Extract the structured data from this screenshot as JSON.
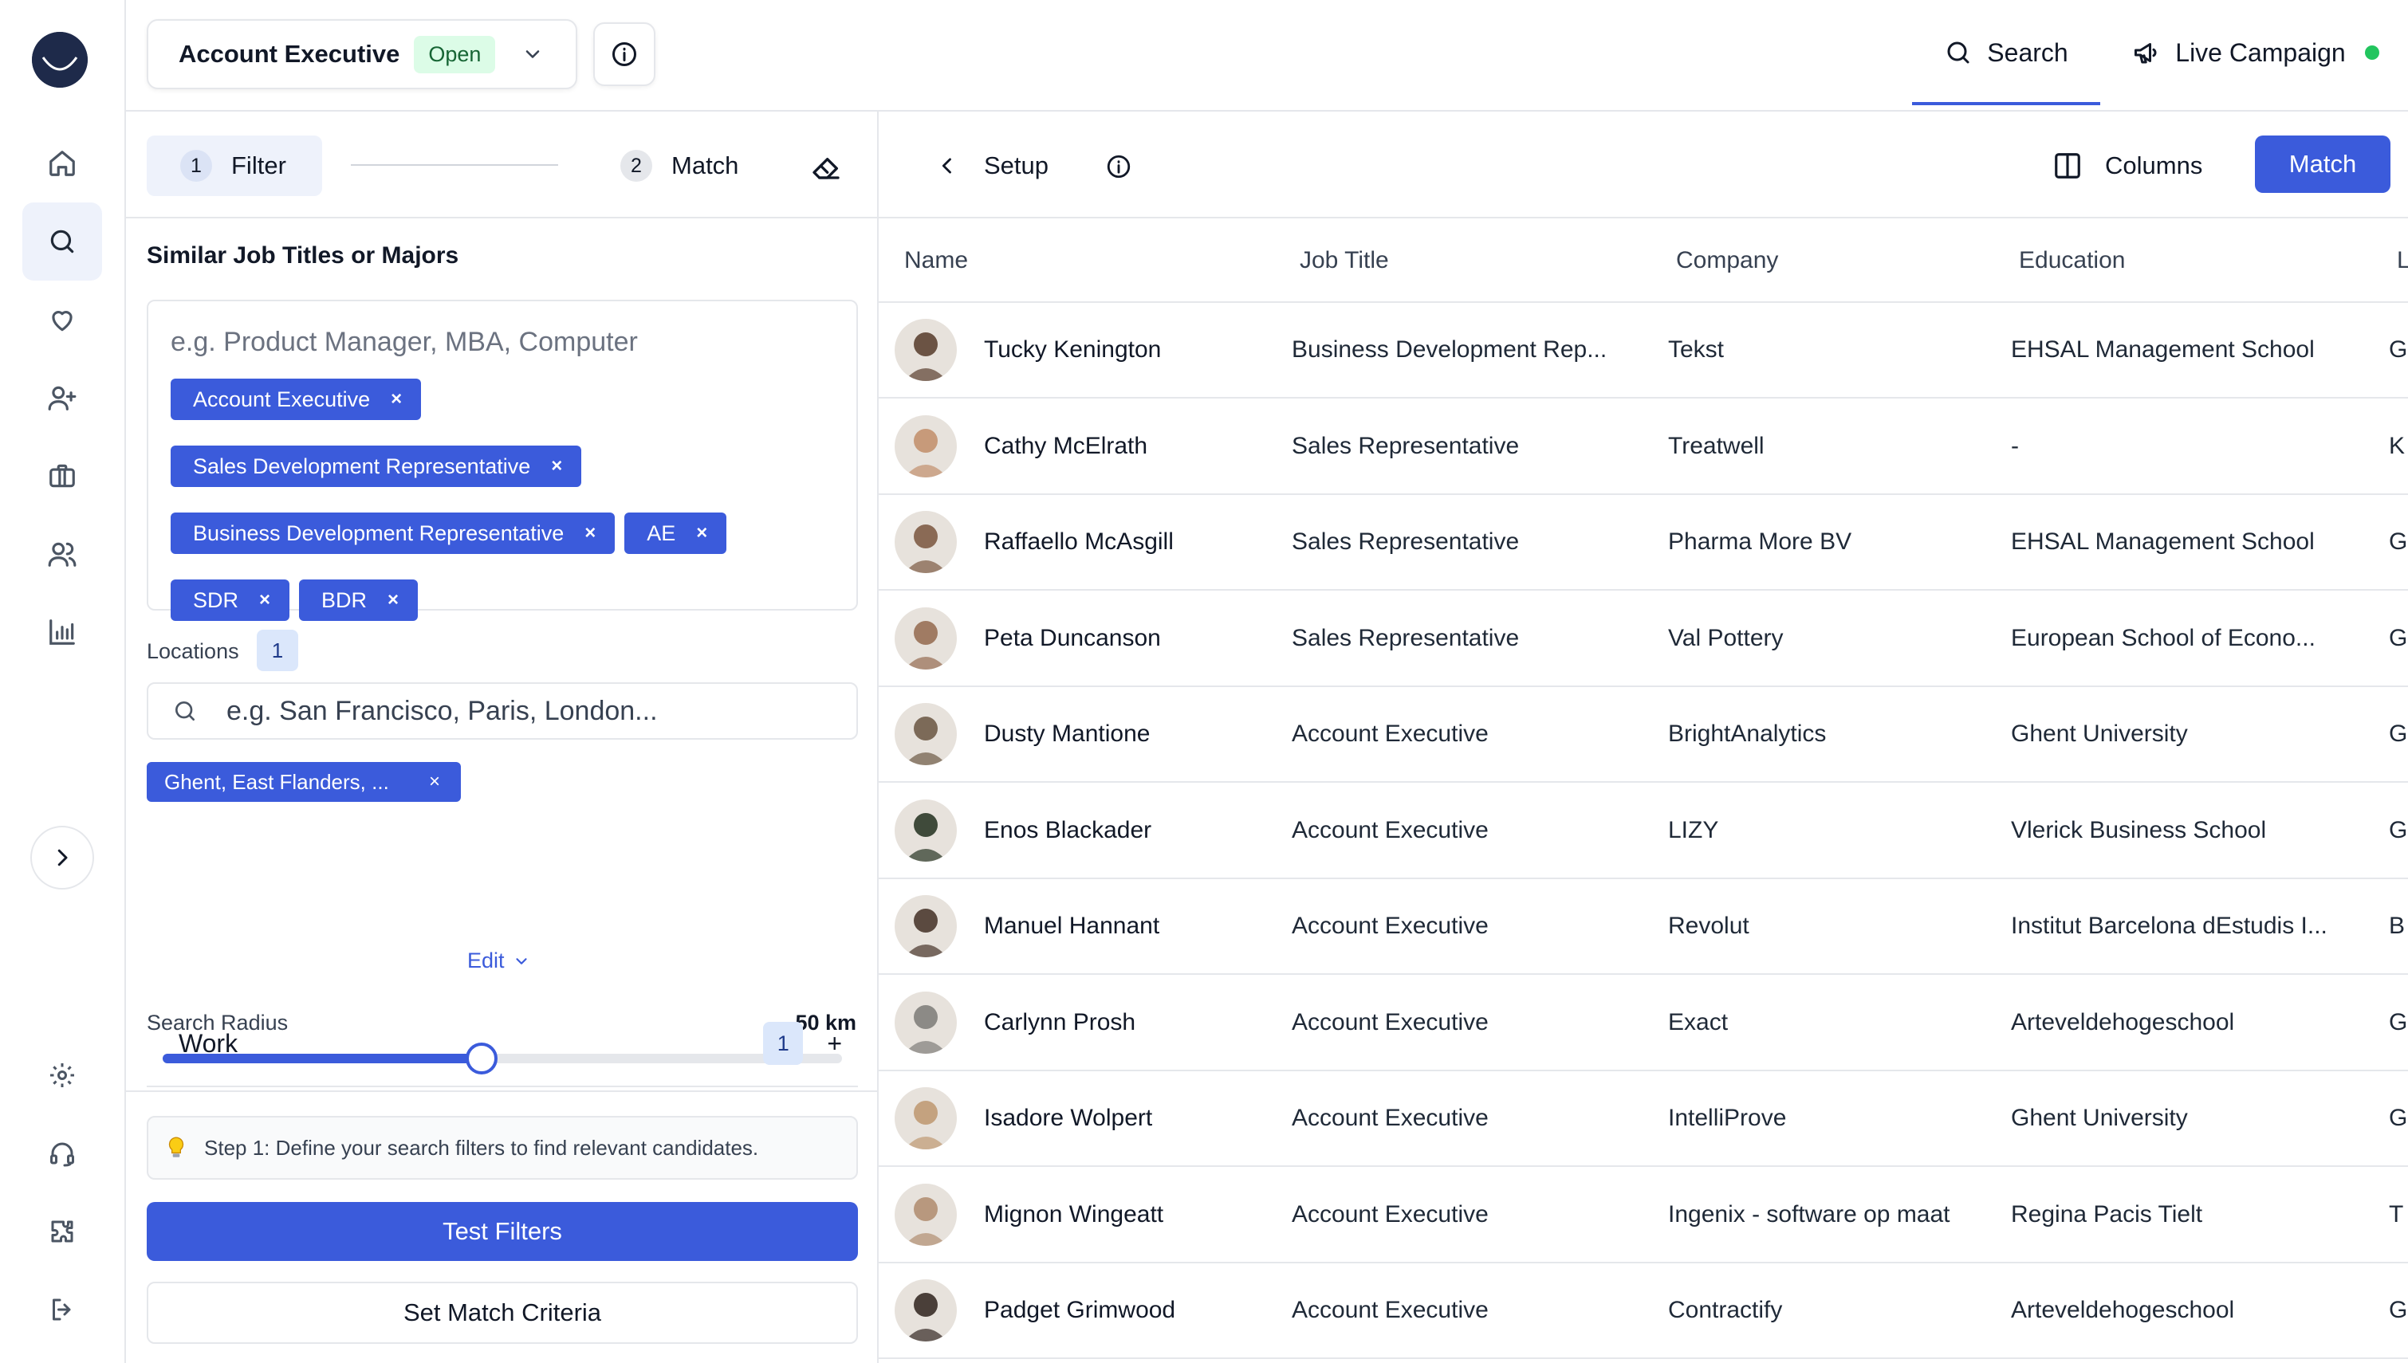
{
  "topbar": {
    "job_title": "Account Executive",
    "job_status": "Open",
    "tabs": [
      {
        "label": "Search",
        "icon": "search-icon",
        "active": true
      },
      {
        "label": "Live Campaign",
        "icon": "megaphone-icon",
        "status_color": "#22c55e"
      }
    ]
  },
  "rail": {
    "items": [
      {
        "name": "home-icon"
      },
      {
        "name": "search-icon",
        "active": true
      },
      {
        "name": "heart-icon"
      },
      {
        "name": "user-plus-icon"
      },
      {
        "name": "briefcase-icon"
      },
      {
        "name": "users-icon"
      },
      {
        "name": "bar-chart-icon"
      }
    ],
    "bottom_items": [
      {
        "name": "gear-icon"
      },
      {
        "name": "headset-icon"
      },
      {
        "name": "puzzle-icon"
      },
      {
        "name": "logout-icon"
      }
    ]
  },
  "steps": [
    {
      "num": "1",
      "label": "Filter",
      "active": true
    },
    {
      "num": "2",
      "label": "Match",
      "active": false
    }
  ],
  "filters": {
    "section_label": "Similar Job Titles or Majors",
    "placeholder": "e.g. Product Manager, MBA, Computer",
    "chips": [
      "Account Executive",
      "Sales Development Representative",
      "Business Development Representative",
      "AE",
      "SDR",
      "BDR"
    ],
    "locations_label": "Locations",
    "locations_count": "1",
    "locations_placeholder": "e.g. San Francisco, Paris, London...",
    "location_chip": "Ghent, East Flanders, ...",
    "edit_label": "Edit",
    "radius_label": "Search Radius",
    "radius_value": "50 km",
    "radius_fraction": 0.47,
    "work_label": "Work",
    "work_count": "1",
    "work_add": "+",
    "hint_icon": "lightbulb-icon",
    "hint": "Step 1: Define your search filters to find relevant candidates.",
    "test_label": "Test Filters",
    "criteria_label": "Set Match Criteria"
  },
  "toolbar": {
    "back_label": "Setup",
    "columns_label": "Columns",
    "match_label": "Match"
  },
  "table": {
    "columns": [
      "Name",
      "Job Title",
      "Company",
      "Education",
      "L"
    ],
    "rows": [
      {
        "name": "Tucky Kenington",
        "job": "Business Development Rep...",
        "company": "Tekst",
        "education": "EHSAL Management School",
        "loc": "G",
        "avatar": "#6b5344"
      },
      {
        "name": "Cathy McElrath",
        "job": "Sales Representative",
        "company": "Treatwell",
        "education": "-",
        "loc": "K",
        "avatar": "#c79a7a"
      },
      {
        "name": "Raffaello McAsgill",
        "job": "Sales Representative",
        "company": "Pharma More BV",
        "education": "EHSAL Management School",
        "loc": "G",
        "avatar": "#8a6a55"
      },
      {
        "name": "Peta Duncanson",
        "job": "Sales Representative",
        "company": "Val Pottery",
        "education": "European School of Econo...",
        "loc": "G",
        "avatar": "#a07b63"
      },
      {
        "name": "Dusty Mantione",
        "job": "Account Executive",
        "company": "BrightAnalytics",
        "education": "Ghent University",
        "loc": "G",
        "avatar": "#7c6a58"
      },
      {
        "name": "Enos Blackader",
        "job": "Account Executive",
        "company": "LIZY",
        "education": "Vlerick Business School",
        "loc": "G",
        "avatar": "#3f4a3a"
      },
      {
        "name": "Manuel Hannant",
        "job": "Account Executive",
        "company": "Revolut",
        "education": "Institut Barcelona dEstudis I...",
        "loc": "B",
        "avatar": "#5b4a40"
      },
      {
        "name": "Carlynn Prosh",
        "job": "Account Executive",
        "company": "Exact",
        "education": "Arteveldehogeschool",
        "loc": "G",
        "avatar": "#8c8a86"
      },
      {
        "name": "Isadore Wolpert",
        "job": "Account Executive",
        "company": "IntelliProve",
        "education": "Ghent University",
        "loc": "G",
        "avatar": "#c4a27f"
      },
      {
        "name": "Mignon Wingeatt",
        "job": "Account Executive",
        "company": "Ingenix - software op maat",
        "education": "Regina Pacis Tielt",
        "loc": "T",
        "avatar": "#b8987e"
      },
      {
        "name": "Padget Grimwood",
        "job": "Account Executive",
        "company": "Contractify",
        "education": "Arteveldehogeschool",
        "loc": "G",
        "avatar": "#4a3f39"
      }
    ]
  }
}
